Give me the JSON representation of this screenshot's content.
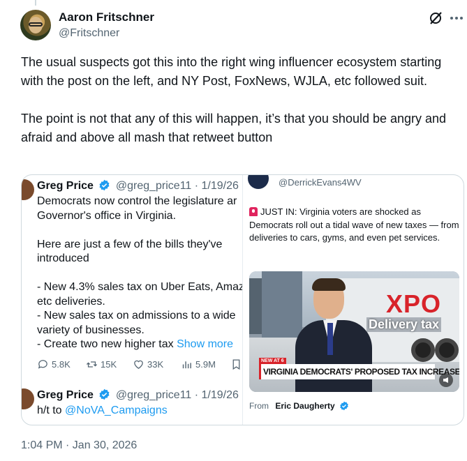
{
  "author": {
    "name": "Aaron Fritschner",
    "handle": "@Fritschner"
  },
  "tweet": {
    "paragraph1": "The usual suspects got this into the right wing influencer ecosystem starting with the post on the left, and NY Post, FoxNews, WJLA, etc followed suit.",
    "paragraph2": "The point is not that any of this will happen, it’s that you should be angry and afraid and above all mash that retweet button",
    "timestamp": "1:04 PM · Jan 30, 2026"
  },
  "left_post": {
    "name": "Greg Price",
    "handle_date": "@greg_price11 · 1/19/26",
    "lines": [
      "Democrats now control the legislature ar",
      "Governor's office in Virginia.",
      "",
      "Here are just a few of the bills they've",
      "introduced",
      "",
      "- New 4.3% sales tax on Uber Eats, Amaz",
      "etc deliveries.",
      "- New sales tax on admissions to a wide",
      "variety of businesses."
    ],
    "last_line": "- Create two new higher tax ",
    "show_more": "Show more",
    "stats": {
      "replies": "5.8K",
      "reposts": "15K",
      "likes": "33K",
      "views": "5.9M"
    },
    "reply_name": "Greg Price",
    "reply_handle_date": "@greg_price11 · 1/19/26",
    "reply_prefix": "h/t to ",
    "reply_mention": "@NoVA_Campaigns"
  },
  "right_post": {
    "handle": "@DerrickEvans4WV",
    "text": "JUST IN: Virginia voters are shocked as Democrats roll out a tidal wave of new taxes — from deliveries to cars, gyms, and even pet services.",
    "video": {
      "truck_logo": "XPO",
      "truck_text": "Delivery tax",
      "badge": "NEW AT 6",
      "lower_third": "VIRGINIA DEMOCRATS' PROPOSED TAX INCREASES"
    },
    "from_label": "From",
    "from_name": "Eric Daugherty"
  },
  "colors": {
    "accent": "#1d9bf0",
    "secondary_text": "#536471",
    "border": "#cfd9de"
  }
}
